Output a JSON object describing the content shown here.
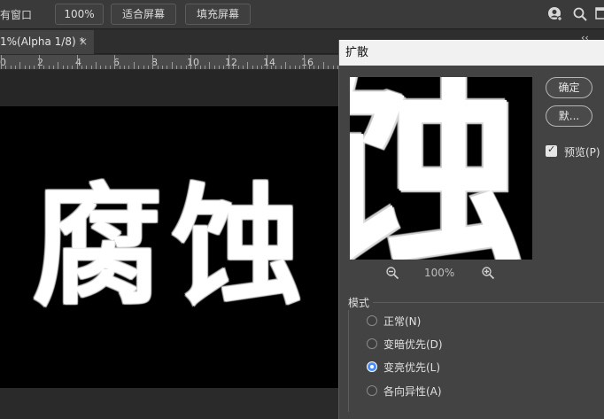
{
  "options_bar": {
    "windows_label": "有窗口",
    "zoom_100_label": "100%",
    "fit_screen_label": "适合屏幕",
    "fill_screen_label": "填充屏幕",
    "icons": [
      "user-sync-icon",
      "search-icon",
      "workspace-icon"
    ]
  },
  "tab": {
    "label": "1%(Alpha 1/8) *",
    "close_glyph": "×",
    "collapse_glyph": "‹‹"
  },
  "ruler": {
    "labels": [
      "0",
      "2",
      "4",
      "6",
      "8",
      "10",
      "12",
      "14",
      "16"
    ]
  },
  "canvas": {
    "text": "腐蚀",
    "background": "#000000",
    "text_color": "#ffffff"
  },
  "dialog": {
    "title": "扩散",
    "preview_text": "蚀",
    "zoom_value": "100%",
    "ok_label": "确定",
    "default_label": "默...",
    "preview_checkbox_label": "预览(P)",
    "preview_checked": true,
    "mode_legend": "模式",
    "modes": [
      {
        "label": "正常(N)",
        "selected": false
      },
      {
        "label": "变暗优先(D)",
        "selected": false
      },
      {
        "label": "变亮优先(L)",
        "selected": true
      },
      {
        "label": "各向异性(A)",
        "selected": false
      }
    ]
  },
  "colors": {
    "panel": "#434343",
    "accent_radio": "#4a8ef7",
    "title_bar": "#f1f1f1"
  }
}
